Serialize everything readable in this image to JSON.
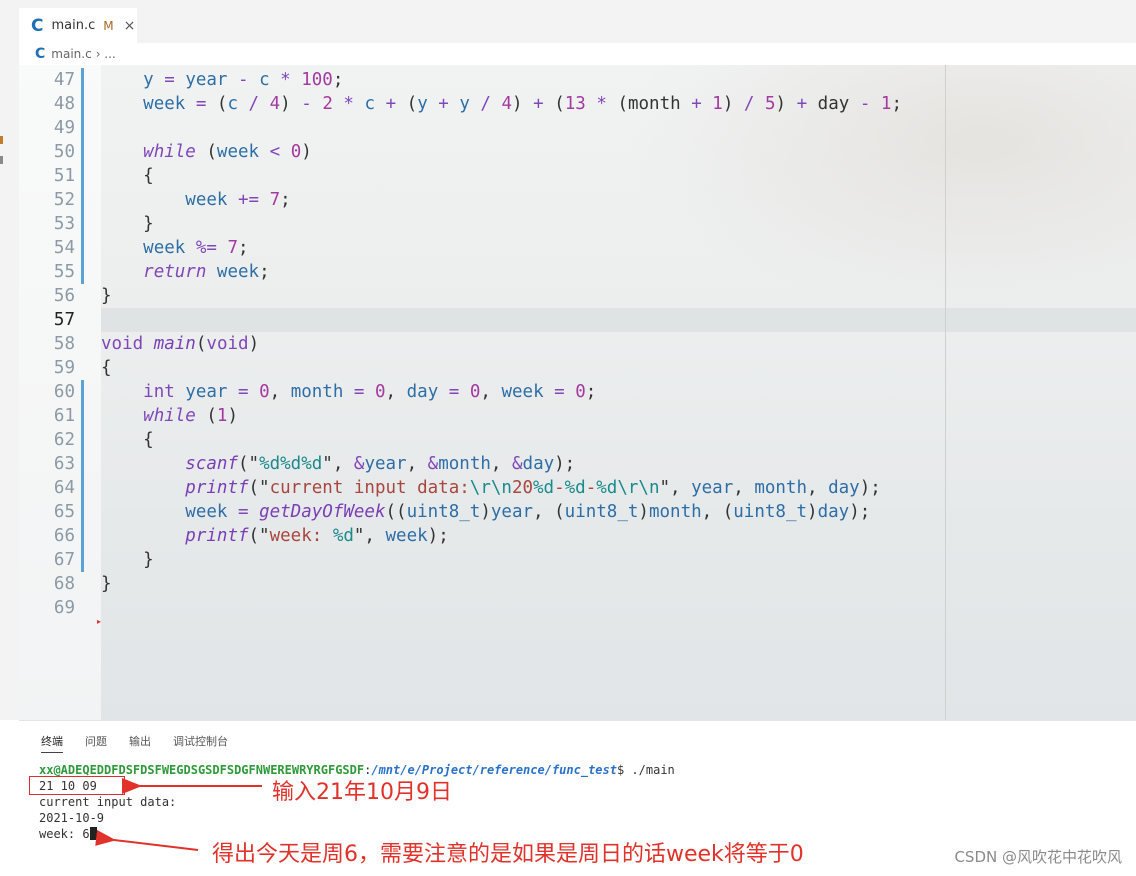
{
  "tab": {
    "icon": "c-language-icon",
    "name": "main.c",
    "status": "M",
    "close": "×"
  },
  "breadcrumb": {
    "file": "main.c",
    "trail": "› ..."
  },
  "panel_tabs": [
    "终端",
    "问题",
    "输出",
    "调试控制台"
  ],
  "terminal": {
    "prompt_user": "xx@ADEQEDDFDSFDSFWEGDSGSDFSDGFNWEREWRYRGFGSDF",
    "prompt_sep": ":",
    "prompt_path": "/mnt/e/Project/reference/func_test",
    "prompt_cmd": "$ ./main",
    "lines": [
      "21 10 09",
      "current input data:",
      "2021-10-9",
      "week: 6"
    ]
  },
  "annotations": {
    "input": "输入21年10月9日",
    "result": "得出今天是周6，需要注意的是如果是周日的话week将等于0"
  },
  "watermark": "CSDN @风吹花中花吹风",
  "active_line": 57,
  "code_lines": [
    {
      "n": "47",
      "segs": [
        [
          "pl",
          "    "
        ],
        [
          "var",
          "y"
        ],
        [
          "op",
          " = "
        ],
        [
          "var",
          "year"
        ],
        [
          "op",
          " - "
        ],
        [
          "var",
          "c"
        ],
        [
          "op",
          " * "
        ],
        [
          "num",
          "100"
        ],
        [
          "pl",
          ";"
        ]
      ]
    },
    {
      "n": "48",
      "segs": [
        [
          "pl",
          "    "
        ],
        [
          "var",
          "week"
        ],
        [
          "op",
          " = "
        ],
        [
          "pl",
          "("
        ],
        [
          "var",
          "c"
        ],
        [
          "op",
          " / "
        ],
        [
          "num",
          "4"
        ],
        [
          "pl",
          ")"
        ],
        [
          "op",
          " - "
        ],
        [
          "num",
          "2"
        ],
        [
          "op",
          " * "
        ],
        [
          "var",
          "c"
        ],
        [
          "op",
          " + "
        ],
        [
          "pl",
          "("
        ],
        [
          "var",
          "y"
        ],
        [
          "op",
          " + "
        ],
        [
          "var",
          "y"
        ],
        [
          "op",
          " / "
        ],
        [
          "num",
          "4"
        ],
        [
          "pl",
          ")"
        ],
        [
          "op",
          " + "
        ],
        [
          "pl",
          "("
        ],
        [
          "num",
          "13"
        ],
        [
          "op",
          " * "
        ],
        [
          "pl",
          "(month"
        ],
        [
          "op",
          " + "
        ],
        [
          "num",
          "1"
        ],
        [
          "pl",
          ")"
        ],
        [
          "op",
          " / "
        ],
        [
          "num",
          "5"
        ],
        [
          "pl",
          ")"
        ],
        [
          "op",
          " + "
        ],
        [
          "pl",
          "day"
        ],
        [
          "op",
          " - "
        ],
        [
          "num",
          "1"
        ],
        [
          "pl",
          ";"
        ]
      ]
    },
    {
      "n": "49",
      "segs": []
    },
    {
      "n": "50",
      "segs": [
        [
          "pl",
          "    "
        ],
        [
          "kw-i",
          "while"
        ],
        [
          "pl",
          " ("
        ],
        [
          "var",
          "week"
        ],
        [
          "op",
          " < "
        ],
        [
          "num",
          "0"
        ],
        [
          "pl",
          ")"
        ]
      ]
    },
    {
      "n": "51",
      "segs": [
        [
          "pl",
          "    {"
        ]
      ]
    },
    {
      "n": "52",
      "segs": [
        [
          "pl",
          "        "
        ],
        [
          "var",
          "week"
        ],
        [
          "op",
          " += "
        ],
        [
          "num",
          "7"
        ],
        [
          "pl",
          ";"
        ]
      ]
    },
    {
      "n": "53",
      "segs": [
        [
          "pl",
          "    }"
        ]
      ]
    },
    {
      "n": "54",
      "segs": [
        [
          "pl",
          "    "
        ],
        [
          "var",
          "week"
        ],
        [
          "op",
          " %= "
        ],
        [
          "num",
          "7"
        ],
        [
          "pl",
          ";"
        ]
      ]
    },
    {
      "n": "55",
      "segs": [
        [
          "pl",
          "    "
        ],
        [
          "kw-i",
          "return"
        ],
        [
          "pl",
          " "
        ],
        [
          "var",
          "week"
        ],
        [
          "pl",
          ";"
        ]
      ]
    },
    {
      "n": "56",
      "segs": [
        [
          "pl",
          "}"
        ]
      ]
    },
    {
      "n": "57",
      "segs": []
    },
    {
      "n": "58",
      "segs": [
        [
          "kw",
          "void"
        ],
        [
          "pl",
          " "
        ],
        [
          "fn",
          "main"
        ],
        [
          "pl",
          "("
        ],
        [
          "kw",
          "void"
        ],
        [
          "pl",
          ")"
        ]
      ]
    },
    {
      "n": "59",
      "segs": [
        [
          "pl",
          "{"
        ]
      ]
    },
    {
      "n": "60",
      "segs": [
        [
          "pl",
          "    "
        ],
        [
          "kw",
          "int"
        ],
        [
          "pl",
          " "
        ],
        [
          "var",
          "year"
        ],
        [
          "op",
          " = "
        ],
        [
          "num",
          "0"
        ],
        [
          "pl",
          ", "
        ],
        [
          "var",
          "month"
        ],
        [
          "op",
          " = "
        ],
        [
          "num",
          "0"
        ],
        [
          "pl",
          ", "
        ],
        [
          "var",
          "day"
        ],
        [
          "op",
          " = "
        ],
        [
          "num",
          "0"
        ],
        [
          "pl",
          ", "
        ],
        [
          "var",
          "week"
        ],
        [
          "op",
          " = "
        ],
        [
          "num",
          "0"
        ],
        [
          "pl",
          ";"
        ]
      ]
    },
    {
      "n": "61",
      "segs": [
        [
          "pl",
          "    "
        ],
        [
          "kw-i",
          "while"
        ],
        [
          "pl",
          " ("
        ],
        [
          "num",
          "1"
        ],
        [
          "pl",
          ")"
        ]
      ]
    },
    {
      "n": "62",
      "segs": [
        [
          "pl",
          "    {"
        ]
      ]
    },
    {
      "n": "63",
      "segs": [
        [
          "pl",
          "        "
        ],
        [
          "fn",
          "scanf"
        ],
        [
          "pl",
          "(\""
        ],
        [
          "esc",
          "%d%d%d"
        ],
        [
          "pl",
          "\", "
        ],
        [
          "op",
          "&"
        ],
        [
          "var",
          "year"
        ],
        [
          "pl",
          ", "
        ],
        [
          "op",
          "&"
        ],
        [
          "var",
          "month"
        ],
        [
          "pl",
          ", "
        ],
        [
          "op",
          "&"
        ],
        [
          "var",
          "day"
        ],
        [
          "pl",
          ");"
        ]
      ]
    },
    {
      "n": "64",
      "segs": [
        [
          "pl",
          "        "
        ],
        [
          "fn",
          "printf"
        ],
        [
          "pl",
          "(\""
        ],
        [
          "str",
          "current input data:"
        ],
        [
          "esc",
          "\\r\\n"
        ],
        [
          "str",
          "20"
        ],
        [
          "esc",
          "%d"
        ],
        [
          "str",
          "-"
        ],
        [
          "esc",
          "%d"
        ],
        [
          "str",
          "-"
        ],
        [
          "esc",
          "%d\\r\\n"
        ],
        [
          "pl",
          "\", "
        ],
        [
          "var",
          "year"
        ],
        [
          "pl",
          ", "
        ],
        [
          "var",
          "month"
        ],
        [
          "pl",
          ", "
        ],
        [
          "var",
          "day"
        ],
        [
          "pl",
          ");"
        ]
      ]
    },
    {
      "n": "65",
      "segs": [
        [
          "pl",
          "        "
        ],
        [
          "var",
          "week"
        ],
        [
          "op",
          " = "
        ],
        [
          "fn",
          "getDayOfWeek"
        ],
        [
          "pl",
          "(("
        ],
        [
          "var",
          "uint8_t"
        ],
        [
          "pl",
          ")"
        ],
        [
          "var",
          "year"
        ],
        [
          "pl",
          ", ("
        ],
        [
          "var",
          "uint8_t"
        ],
        [
          "pl",
          ")"
        ],
        [
          "var",
          "month"
        ],
        [
          "pl",
          ", ("
        ],
        [
          "var",
          "uint8_t"
        ],
        [
          "pl",
          ")"
        ],
        [
          "var",
          "day"
        ],
        [
          "pl",
          ");"
        ]
      ]
    },
    {
      "n": "66",
      "segs": [
        [
          "pl",
          "        "
        ],
        [
          "fn",
          "printf"
        ],
        [
          "pl",
          "(\""
        ],
        [
          "str",
          "week: "
        ],
        [
          "esc",
          "%d"
        ],
        [
          "pl",
          "\", "
        ],
        [
          "var",
          "week"
        ],
        [
          "pl",
          ");"
        ]
      ]
    },
    {
      "n": "67",
      "segs": [
        [
          "pl",
          "    }"
        ]
      ]
    },
    {
      "n": "68",
      "segs": [
        [
          "pl",
          "}"
        ]
      ]
    },
    {
      "n": "69",
      "segs": []
    }
  ],
  "partial_top_line": "    ... }"
}
